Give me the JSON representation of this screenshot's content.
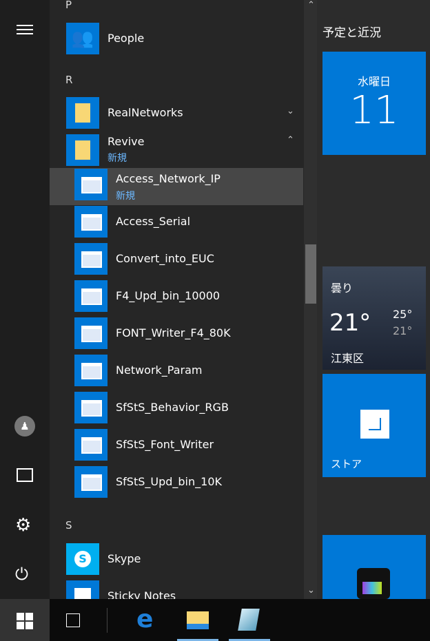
{
  "sections": {
    "p": "P",
    "r": "R",
    "s": "S"
  },
  "apps": {
    "people": "People",
    "realnetworks": "RealNetworks",
    "revive": {
      "label": "Revive",
      "badge": "新規"
    },
    "revive_items": [
      {
        "label": "Access_Network_IP",
        "badge": "新規"
      },
      {
        "label": "Access_Serial"
      },
      {
        "label": "Convert_into_EUC"
      },
      {
        "label": "F4_Upd_bin_10000"
      },
      {
        "label": "FONT_Writer_F4_80K"
      },
      {
        "label": "Network_Param"
      },
      {
        "label": "SfStS_Behavior_RGB"
      },
      {
        "label": "SfStS_Font_Writer"
      },
      {
        "label": "SfStS_Upd_bin_10K"
      }
    ],
    "skype": "Skype",
    "sticky": "Sticky Notes"
  },
  "tiles": {
    "group_title": "予定と近況",
    "calendar": {
      "day": "水曜日",
      "date": "11"
    },
    "weather": {
      "condition": "曇り",
      "temp": "21°",
      "high": "25°",
      "low": "21°",
      "location": "江東区"
    },
    "store": "ストア"
  },
  "colors": {
    "accent": "#0078d7",
    "badge": "#6cb8ff"
  }
}
